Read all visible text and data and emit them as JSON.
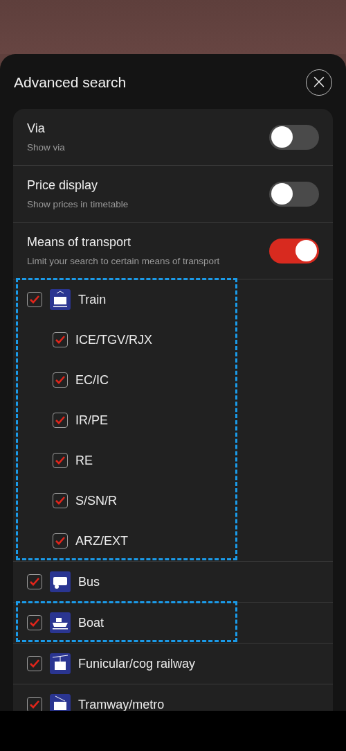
{
  "sheet": {
    "title": "Advanced search",
    "close_label": "×"
  },
  "settings": [
    {
      "title": "Via",
      "subtitle": "Show via",
      "on": false
    },
    {
      "title": "Price display",
      "subtitle": "Show prices in timetable",
      "on": false
    },
    {
      "title": "Means of transport",
      "subtitle": "Limit your search to certain means of transport",
      "on": true
    }
  ],
  "transport": [
    {
      "label": "Train",
      "checked": true,
      "highlighted": true,
      "children": [
        {
          "label": "ICE/TGV/RJX",
          "checked": true
        },
        {
          "label": "EC/IC",
          "checked": true
        },
        {
          "label": "IR/PE",
          "checked": true
        },
        {
          "label": "RE",
          "checked": true
        },
        {
          "label": "S/SN/R",
          "checked": true
        },
        {
          "label": "ARZ/EXT",
          "checked": true
        }
      ]
    },
    {
      "label": "Bus",
      "checked": true,
      "highlighted": false
    },
    {
      "label": "Boat",
      "checked": true,
      "highlighted": true
    },
    {
      "label": "Funicular/cog railway",
      "checked": true,
      "highlighted": false
    },
    {
      "label": "Tramway/metro",
      "checked": true,
      "highlighted": false
    }
  ]
}
